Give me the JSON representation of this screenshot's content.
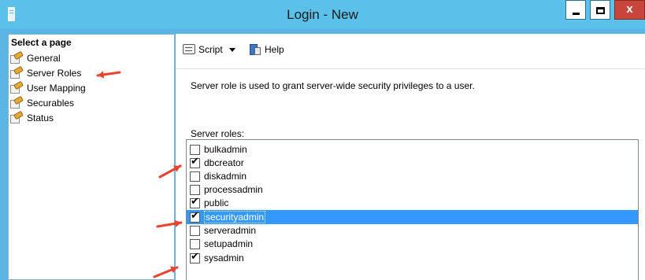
{
  "window": {
    "title": "Login - New",
    "close_glyph": "x"
  },
  "left_pane": {
    "header": "Select a page",
    "items": [
      {
        "label": "General"
      },
      {
        "label": "Server Roles"
      },
      {
        "label": "User Mapping"
      },
      {
        "label": "Securables"
      },
      {
        "label": "Status"
      }
    ]
  },
  "toolbar": {
    "script_label": "Script",
    "help_label": "Help"
  },
  "main": {
    "description": "Server role is used to grant server-wide security privileges to a user.",
    "roles_label": "Server roles:",
    "roles": [
      {
        "name": "bulkadmin",
        "checked": false,
        "selected": false
      },
      {
        "name": "dbcreator",
        "checked": true,
        "selected": false
      },
      {
        "name": "diskadmin",
        "checked": false,
        "selected": false
      },
      {
        "name": "processadmin",
        "checked": false,
        "selected": false
      },
      {
        "name": "public",
        "checked": true,
        "selected": false
      },
      {
        "name": "securityadmin",
        "checked": true,
        "selected": true
      },
      {
        "name": "serveradmin",
        "checked": false,
        "selected": false
      },
      {
        "name": "setupadmin",
        "checked": false,
        "selected": false
      },
      {
        "name": "sysadmin",
        "checked": true,
        "selected": false
      }
    ]
  },
  "annotation": {
    "arrow_color": "#e8442e"
  }
}
